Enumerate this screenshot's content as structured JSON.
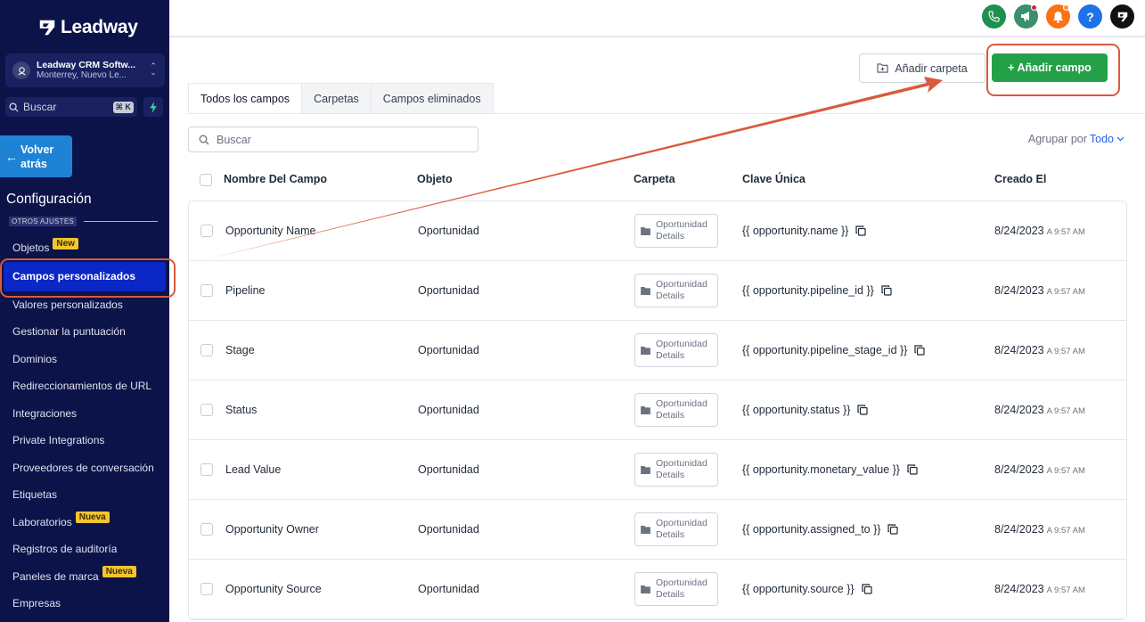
{
  "brand": {
    "name": "Leadway"
  },
  "account": {
    "name": "Leadway CRM Softw...",
    "location": "Monterrey, Nuevo Le..."
  },
  "sidebar": {
    "search_placeholder": "Buscar",
    "search_shortcut": "⌘ K",
    "back_label_1": "Volver",
    "back_label_2": "atrás",
    "config_title": "Configuración",
    "section_label": "OTROS AJUSTES",
    "items": [
      {
        "label": "Objetos",
        "badge": "New"
      },
      {
        "label": "Campos personalizados",
        "active": true
      },
      {
        "label": "Valores personalizados"
      },
      {
        "label": "Gestionar la puntuación"
      },
      {
        "label": "Dominios"
      },
      {
        "label": "Redireccionamientos de URL"
      },
      {
        "label": "Integraciones"
      },
      {
        "label": "Private Integrations"
      },
      {
        "label": "Proveedores de conversación"
      },
      {
        "label": "Etiquetas"
      },
      {
        "label": "Laboratorios",
        "badge": "Nueva"
      },
      {
        "label": "Registros de auditoría"
      },
      {
        "label": "Paneles de marca",
        "badge": "Nueva"
      },
      {
        "label": "Empresas"
      }
    ]
  },
  "topbar": {
    "icons": [
      {
        "name": "phone-icon",
        "color": "#1e8f4e"
      },
      {
        "name": "megaphone-icon",
        "color": "#3b8f6c"
      },
      {
        "name": "bell-icon",
        "color": "#f97316"
      },
      {
        "name": "help-icon",
        "color": "#1d72e8"
      },
      {
        "name": "leadway-icon",
        "color": "#111111"
      }
    ]
  },
  "actions": {
    "add_folder": "Añadir carpeta",
    "add_field": "+ Añadir campo"
  },
  "tabs": [
    "Todos los campos",
    "Carpetas",
    "Campos eliminados"
  ],
  "search": {
    "placeholder": "Buscar"
  },
  "group_by": {
    "label": "Agrupar por",
    "value": "Todo"
  },
  "table": {
    "headers": [
      "Nombre Del Campo",
      "Objeto",
      "Carpeta",
      "Clave Única",
      "Creado El"
    ],
    "rows": [
      {
        "name": "Opportunity Name",
        "object": "Oportunidad",
        "folder_1": "Oportunidad",
        "folder_2": "Details",
        "key": "{{ opportunity.name }}",
        "date": "8/24/2023",
        "time": "A 9:57 AM"
      },
      {
        "name": "Pipeline",
        "object": "Oportunidad",
        "folder_1": "Oportunidad",
        "folder_2": "Details",
        "key": "{{ opportunity.pipeline_id }}",
        "date": "8/24/2023",
        "time": "A 9:57 AM"
      },
      {
        "name": "Stage",
        "object": "Oportunidad",
        "folder_1": "Oportunidad",
        "folder_2": "Details",
        "key": "{{ opportunity.pipeline_stage_id }}",
        "date": "8/24/2023",
        "time": "A 9:57 AM"
      },
      {
        "name": "Status",
        "object": "Oportunidad",
        "folder_1": "Oportunidad",
        "folder_2": "Details",
        "key": "{{ opportunity.status }}",
        "date": "8/24/2023",
        "time": "A 9:57 AM"
      },
      {
        "name": "Lead Value",
        "object": "Oportunidad",
        "folder_1": "Oportunidad",
        "folder_2": "Details",
        "key": "{{ opportunity.monetary_value }}",
        "date": "8/24/2023",
        "time": "A 9:57 AM"
      },
      {
        "name": "Opportunity Owner",
        "object": "Oportunidad",
        "folder_1": "Oportunidad",
        "folder_2": "Details",
        "key": "{{ opportunity.assigned_to }}",
        "date": "8/24/2023",
        "time": "A 9:57 AM"
      },
      {
        "name": "Opportunity Source",
        "object": "Oportunidad",
        "folder_1": "Oportunidad",
        "folder_2": "Details",
        "key": "{{ opportunity.source }}",
        "date": "8/24/2023",
        "time": "A 9:57 AM"
      }
    ]
  },
  "colors": {
    "sidebar": "#0c1349",
    "active_nav": "#0b27c5",
    "primary": "#24a148",
    "annotation": "#d95a3c"
  }
}
